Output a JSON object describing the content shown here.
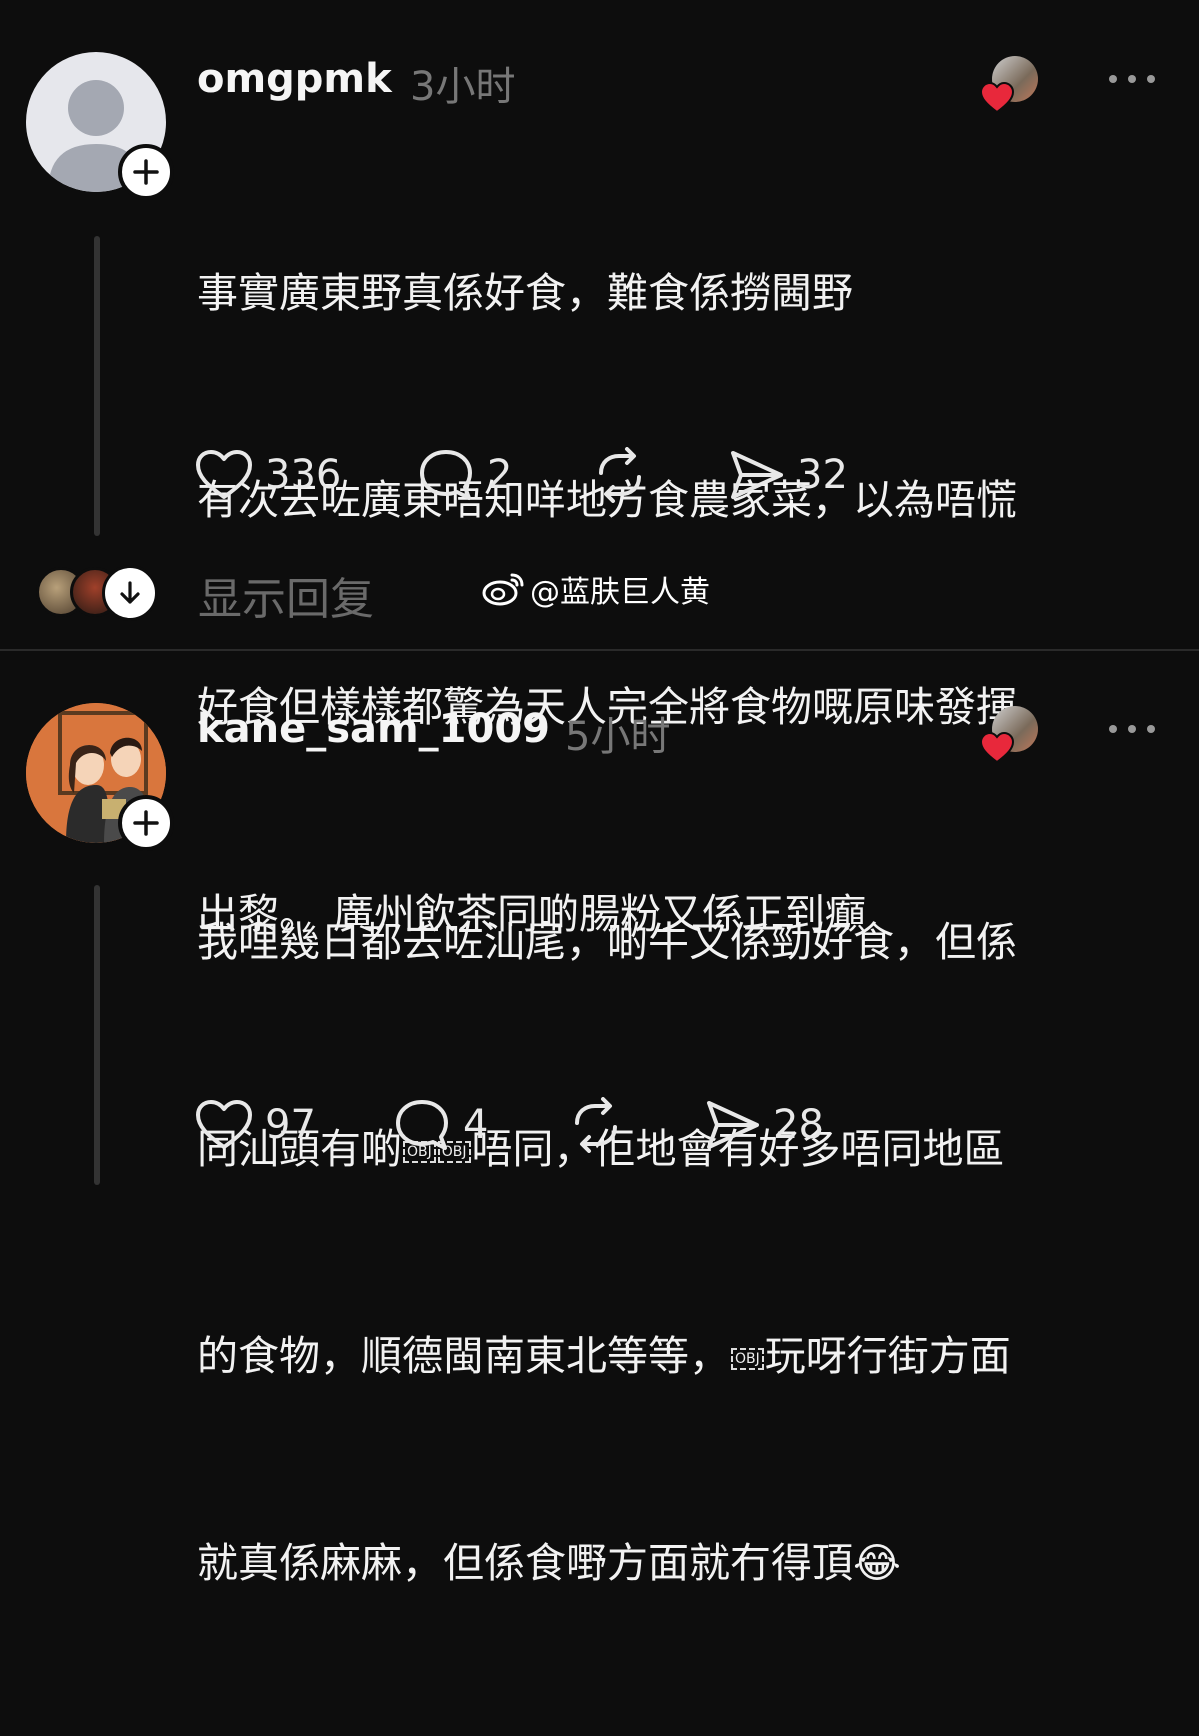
{
  "posts": [
    {
      "username": "omgpmk",
      "time": "3小时",
      "lines": [
        "事實廣東野真係好食，難食係撈閪野",
        "有次去咗廣東唔知咩地方食農家菜，以為唔慌",
        "好食但樣樣都驚為天人完全將食物嘅原味發揮",
        "出黎。 廣州飲茶同啲腸粉又係正到癲"
      ],
      "likes": "336",
      "comments": "2",
      "shares": "32",
      "show_replies": "显示回复",
      "watermark": "@蓝肤巨人黄"
    },
    {
      "username": "kane_sam_1009",
      "time": "5小时",
      "line1": "我哩幾日都去咗汕尾，啲牛又係勁好食，但係",
      "line2_a": "同汕頭有啲",
      "line2_b": "唔同，佢地會有好多唔同地區",
      "line3_a": "的食物，順德閩南東北等等，",
      "line3_b": "玩呀行街方面",
      "line4": "就真係麻麻，但係食嘢方面就冇得頂",
      "obj": "OBJ",
      "emoji": "😂",
      "likes": "97",
      "comments": "4",
      "shares": "28"
    }
  ],
  "colors": {
    "background": "#0d0d0d",
    "muted": "#777777",
    "heart_red": "#e8283b",
    "avatar_orange": "#d9763d"
  },
  "icons": [
    "heart-icon",
    "comment-icon",
    "repost-icon",
    "send-icon",
    "plus-icon",
    "more-icon",
    "arrow-down-icon",
    "weibo-icon"
  ]
}
